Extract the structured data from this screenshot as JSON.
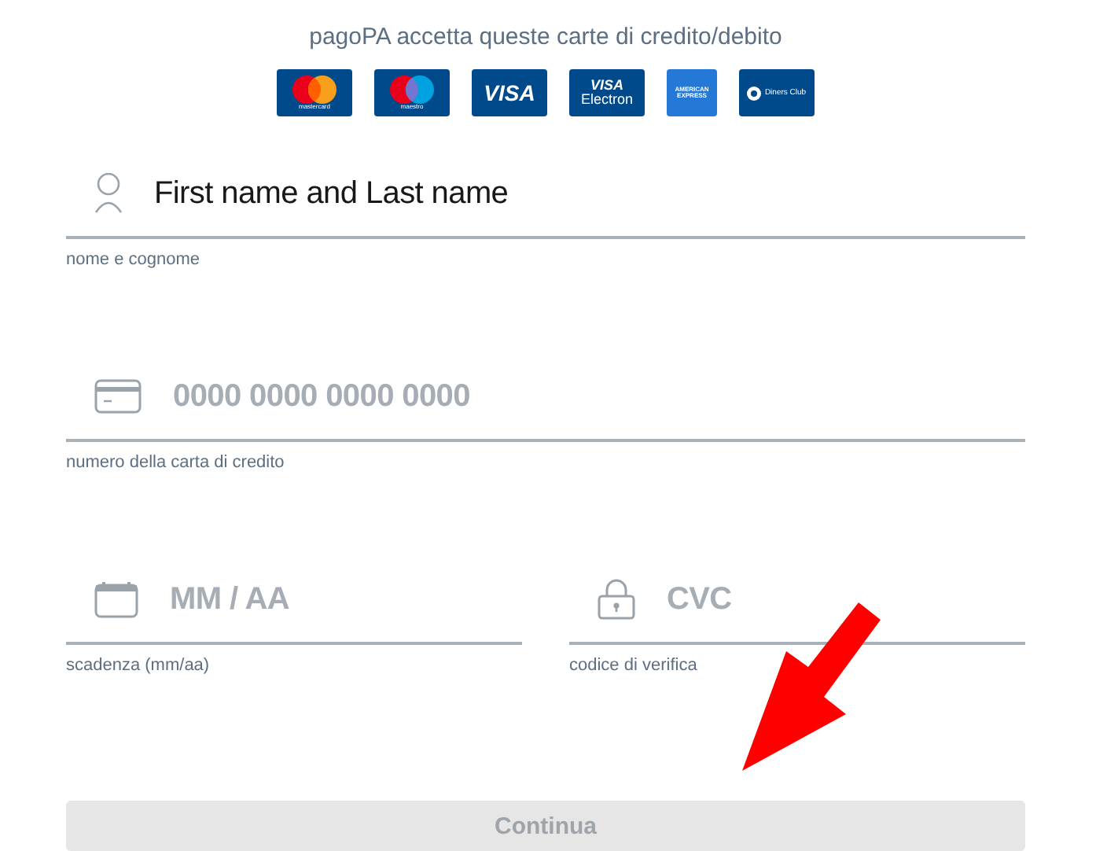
{
  "header": {
    "text": "pagoPA accetta queste carte di credito/debito"
  },
  "cards": [
    {
      "kind": "mastercard",
      "label": "mastercard"
    },
    {
      "kind": "maestro",
      "label": "maestro"
    },
    {
      "kind": "visa",
      "label": "VISA"
    },
    {
      "kind": "electron",
      "label": "VISA",
      "sublabel": "Electron"
    },
    {
      "kind": "amex",
      "label": "AMERICAN",
      "sublabel": "EXPRESS"
    },
    {
      "kind": "diners",
      "label": "Diners Club"
    }
  ],
  "fields": [
    {
      "kind": "person",
      "value": "First name and Last name",
      "helper": "nome e cognome"
    },
    {
      "kind": "card",
      "placeholder": "0000 0000 0000 0000",
      "helper": "numero della carta di credito"
    }
  ],
  "half_fields": [
    {
      "kind": "calendar",
      "placeholder": "MM / AA",
      "helper": "scadenza (mm/aa)"
    },
    {
      "kind": "lock",
      "placeholder": "CVC",
      "helper": "codice di verifica"
    }
  ],
  "button": {
    "label": "Continua",
    "disabled": true
  },
  "annotation": {
    "kind": "arrow"
  }
}
